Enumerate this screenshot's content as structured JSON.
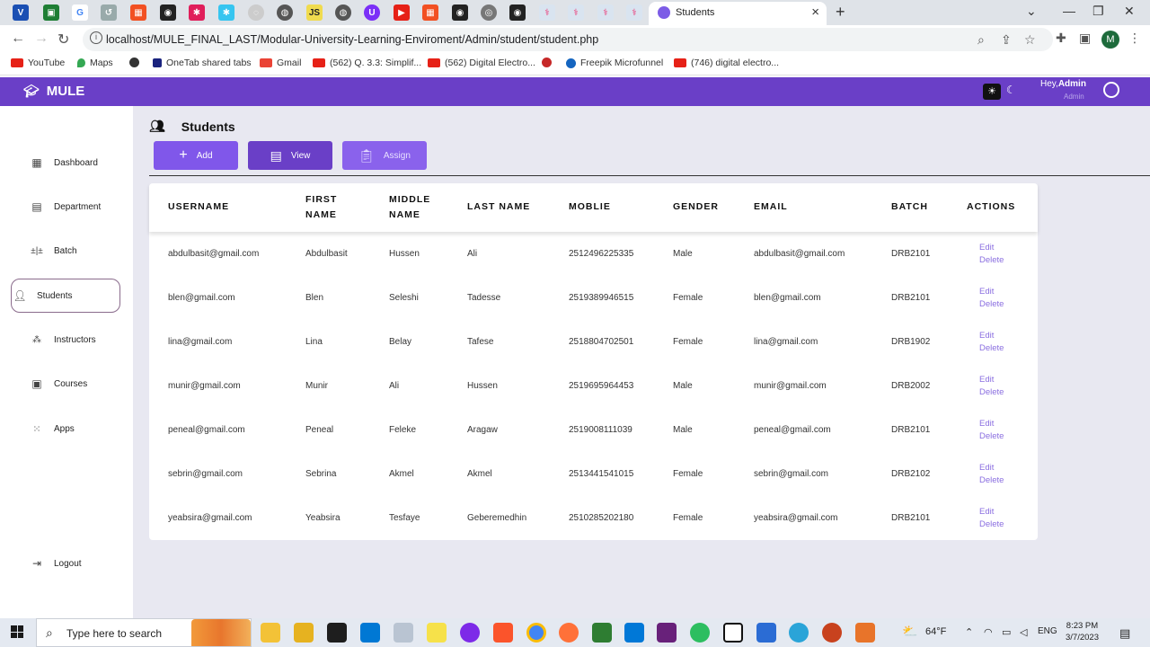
{
  "browser": {
    "active_tab_title": "Students",
    "url": "localhost/MULE_FINAL_LAST/Modular-University-Learning-Enviroment/Admin/student/student.php",
    "profile_initial": "M",
    "bookmarks": [
      {
        "label": "YouTube",
        "color": "#e62117"
      },
      {
        "label": "Maps",
        "color": "#34a853"
      },
      {
        "label": "",
        "color": "#333333"
      },
      {
        "label": "OneTab shared tabs",
        "color": "#1a237e"
      },
      {
        "label": "Gmail",
        "color": "#ea4335"
      },
      {
        "label": "(562) Q. 3.3: Simplif...",
        "color": "#e62117"
      },
      {
        "label": "(562) Digital Electro...",
        "color": "#e62117"
      },
      {
        "label": "",
        "color": "#c62828"
      },
      {
        "label": "Freepik Microfunnel",
        "color": "#1565c0"
      },
      {
        "label": "(746) digital electro...",
        "color": "#e62117"
      }
    ]
  },
  "app": {
    "logo": "MULE",
    "greeting_prefix": "Hey,",
    "greeting_name": "Admin",
    "role": "Admin"
  },
  "sidebar": {
    "items": [
      {
        "label": "Dashboard",
        "icon": "dashboard-icon"
      },
      {
        "label": "Department",
        "icon": "table-icon"
      },
      {
        "label": "Batch",
        "icon": "batch-icon"
      },
      {
        "label": "Students",
        "icon": "students-icon"
      },
      {
        "label": "Instructors",
        "icon": "instructors-icon"
      },
      {
        "label": "Courses",
        "icon": "courses-icon"
      },
      {
        "label": "Apps",
        "icon": "apps-grid-icon"
      }
    ],
    "logout": "Logout"
  },
  "page": {
    "title": "Students",
    "buttons": {
      "add": "Add",
      "view": "View",
      "assign": "Assign"
    }
  },
  "table": {
    "headers": {
      "username": "USERNAME",
      "first_1": "FIRST",
      "first_2": "NAME",
      "middle_1": "MIDDLE",
      "middle_2": "NAME",
      "last": "LAST NAME",
      "mobile": "MOBLIE",
      "gender": "GENDER",
      "email": "EMAIL",
      "batch": "BATCH",
      "actions": "ACTIONS"
    },
    "edit_label": "Edit",
    "delete_label": "Delete",
    "rows": [
      {
        "username": "abdulbasit@gmail.com",
        "first": "Abdulbasit",
        "middle": "Hussen",
        "last": "Ali",
        "mobile": "2512496225335",
        "gender": "Male",
        "email": "abdulbasit@gmail.com",
        "batch": "DRB2101"
      },
      {
        "username": "blen@gmail.com",
        "first": "Blen",
        "middle": "Seleshi",
        "last": "Tadesse",
        "mobile": "2519389946515",
        "gender": "Female",
        "email": "blen@gmail.com",
        "batch": "DRB2101"
      },
      {
        "username": "lina@gmail.com",
        "first": "Lina",
        "middle": "Belay",
        "last": "Tafese",
        "mobile": "2518804702501",
        "gender": "Female",
        "email": "lina@gmail.com",
        "batch": "DRB1902"
      },
      {
        "username": "munir@gmail.com",
        "first": "Munir",
        "middle": "Ali",
        "last": "Hussen",
        "mobile": "2519695964453",
        "gender": "Male",
        "email": "munir@gmail.com",
        "batch": "DRB2002"
      },
      {
        "username": "peneal@gmail.com",
        "first": "Peneal",
        "middle": "Feleke",
        "last": "Aragaw",
        "mobile": "2519008111039",
        "gender": "Male",
        "email": "peneal@gmail.com",
        "batch": "DRB2101"
      },
      {
        "username": "sebrin@gmail.com",
        "first": "Sebrina",
        "middle": "Akmel",
        "last": "Akmel",
        "mobile": "2513441541015",
        "gender": "Female",
        "email": "sebrin@gmail.com",
        "batch": "DRB2102"
      },
      {
        "username": "yeabsira@gmail.com",
        "first": "Yeabsira",
        "middle": "Tesfaye",
        "last": "Geberemedhin",
        "mobile": "2510285202180",
        "gender": "Female",
        "email": "yeabsira@gmail.com",
        "batch": "DRB2101"
      }
    ]
  },
  "taskbar": {
    "search_placeholder": "Type here to search",
    "weather": "64°F",
    "language": "ENG",
    "time": "8:23 PM",
    "date": "3/7/2023"
  }
}
